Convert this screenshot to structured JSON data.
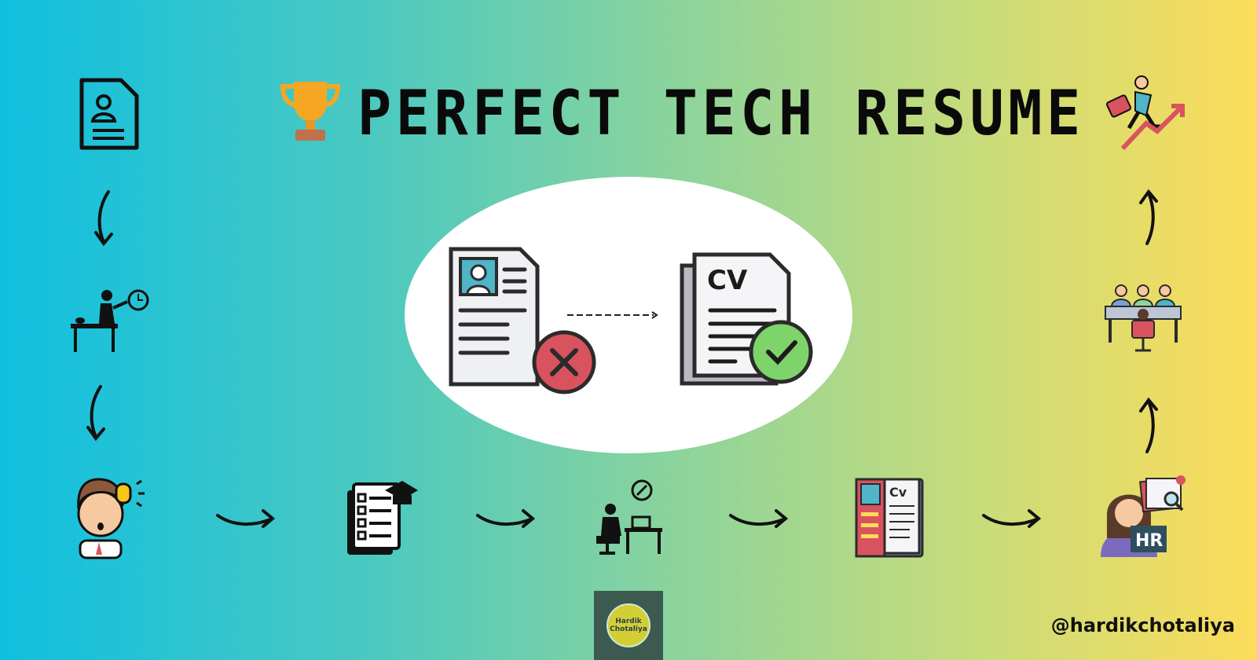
{
  "title": "PERFECT TECH RESUME",
  "handle": "@hardikchotaliya",
  "logo": {
    "line1": "Hardik",
    "line2": "Chotaliya"
  },
  "center": {
    "right_doc_label": "CV"
  },
  "steps": [
    {
      "icon": "resume-document-icon"
    },
    {
      "icon": "person-working-desk-icon"
    },
    {
      "icon": "thinking-boy-idea-icon"
    },
    {
      "icon": "education-checklist-icon"
    },
    {
      "icon": "person-writing-laptop-icon"
    },
    {
      "icon": "cv-document-icon"
    },
    {
      "icon": "hr-recruiter-icon"
    },
    {
      "icon": "interview-panel-icon"
    },
    {
      "icon": "career-growth-icon"
    }
  ],
  "hr_badge": "HR",
  "cv_badge": "Cv",
  "colors": {
    "accent_red": "#d9535f",
    "accent_green": "#7ed36b",
    "trophy": "#f5a623"
  }
}
